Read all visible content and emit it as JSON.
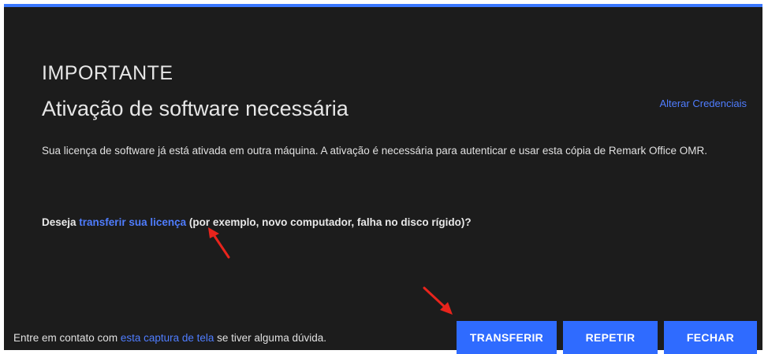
{
  "dialog": {
    "heading": "IMPORTANTE",
    "title": "Ativação de software necessária",
    "change_credentials_link": "Alterar Credenciais",
    "body": "Sua licença de software já está ativada em outra máquina. A ativação é necessária para autenticar e usar esta cópia de Remark Office OMR.",
    "question": {
      "prefix": "Deseja ",
      "link": "transferir sua licença",
      "suffix": " (por exemplo, novo computador, falha no disco rígido)?"
    },
    "footer": {
      "prefix": "Entre em contato com ",
      "link": "esta captura de tela",
      "suffix": " se tiver alguma dúvida."
    },
    "buttons": {
      "transfer": "TRANSFERIR",
      "retry": "REPETIR",
      "close": "FECHAR"
    }
  },
  "colors": {
    "background": "#1c1c1c",
    "accent": "#2f6bff",
    "link": "#4f7dff",
    "arrow": "#e8241c"
  },
  "icons": {
    "annotation_arrows": "red-arrow-icon"
  }
}
